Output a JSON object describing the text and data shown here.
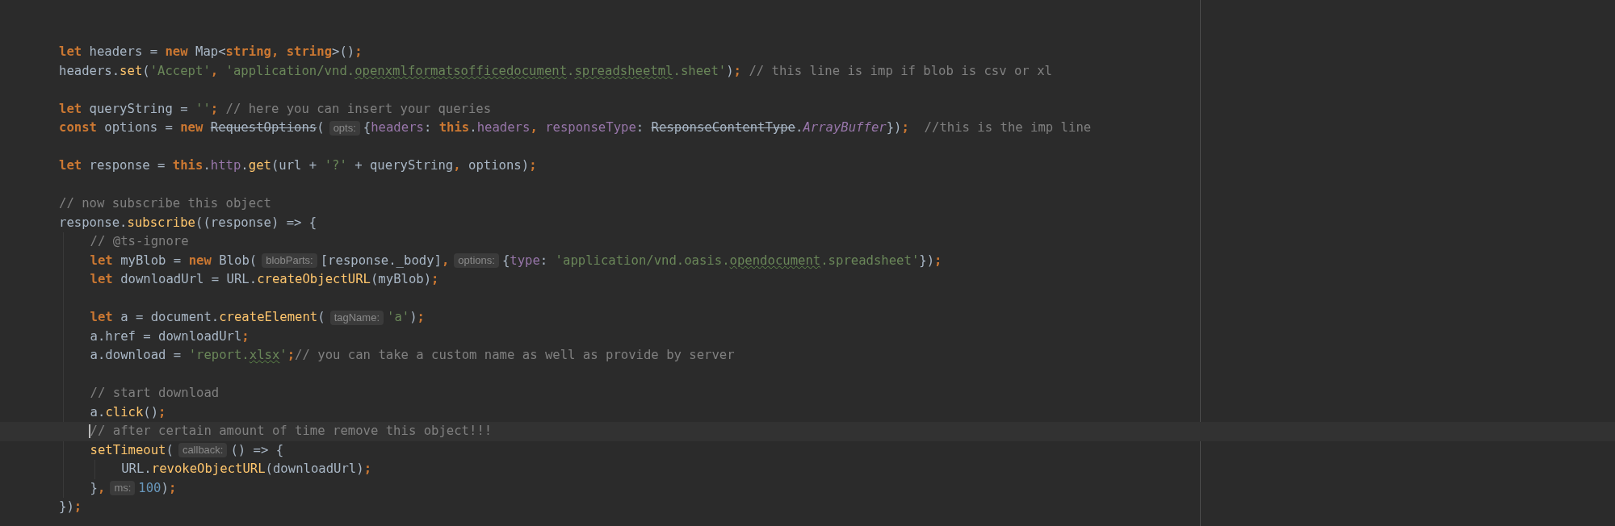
{
  "editor": {
    "lines": [
      {
        "kind": "code",
        "current": false,
        "tokens": [
          {
            "kind": "kw",
            "text": "let"
          },
          {
            "kind": "plain",
            "text": " headers = "
          },
          {
            "kind": "kw",
            "text": "new"
          },
          {
            "kind": "plain",
            "text": " Map<"
          },
          {
            "kind": "kw",
            "text": "string, string"
          },
          {
            "kind": "plain",
            "text": ">()"
          },
          {
            "kind": "punct",
            "text": ";"
          }
        ]
      },
      {
        "kind": "code",
        "current": false,
        "tokens": [
          {
            "kind": "plain",
            "text": "headers."
          },
          {
            "kind": "fn",
            "text": "set"
          },
          {
            "kind": "plain",
            "text": "("
          },
          {
            "kind": "str",
            "text": "'Accept'"
          },
          {
            "kind": "punct",
            "text": ", "
          },
          {
            "kind": "str",
            "text": "'application/vnd."
          },
          {
            "kind": "typo",
            "text": "openxmlformatsofficedocument"
          },
          {
            "kind": "str",
            "text": "."
          },
          {
            "kind": "typo",
            "text": "spreadsheetml"
          },
          {
            "kind": "str",
            "text": ".sheet'"
          },
          {
            "kind": "plain",
            "text": ")"
          },
          {
            "kind": "punct",
            "text": ";"
          },
          {
            "kind": "cmt",
            "text": " // this line is imp if blob is csv or xl"
          }
        ]
      },
      {
        "kind": "blank",
        "current": false
      },
      {
        "kind": "code",
        "current": false,
        "tokens": [
          {
            "kind": "kw",
            "text": "let"
          },
          {
            "kind": "plain",
            "text": " queryString = "
          },
          {
            "kind": "str",
            "text": "''"
          },
          {
            "kind": "punct",
            "text": ";"
          },
          {
            "kind": "cmt",
            "text": " // here you can insert your queries"
          }
        ]
      },
      {
        "kind": "code",
        "current": false,
        "tokens": [
          {
            "kind": "kw",
            "text": "const"
          },
          {
            "kind": "plain",
            "text": " options = "
          },
          {
            "kind": "kw",
            "text": "new "
          },
          {
            "kind": "strike",
            "text": "RequestOptions"
          },
          {
            "kind": "plain",
            "text": "("
          },
          {
            "kind": "hint",
            "text": "opts:"
          },
          {
            "kind": "plain",
            "text": "{"
          },
          {
            "kind": "prop",
            "text": "headers"
          },
          {
            "kind": "plain",
            "text": ": "
          },
          {
            "kind": "kw",
            "text": "this"
          },
          {
            "kind": "plain",
            "text": "."
          },
          {
            "kind": "prop",
            "text": "headers"
          },
          {
            "kind": "punct",
            "text": ", "
          },
          {
            "kind": "prop",
            "text": "responseType"
          },
          {
            "kind": "plain",
            "text": ": "
          },
          {
            "kind": "strike",
            "text": "ResponseContentType"
          },
          {
            "kind": "plain",
            "text": "."
          },
          {
            "kind": "enum",
            "text": "ArrayBuffer"
          },
          {
            "kind": "plain",
            "text": "})"
          },
          {
            "kind": "punct",
            "text": ";"
          },
          {
            "kind": "cmt",
            "text": "  //this is the imp line"
          }
        ]
      },
      {
        "kind": "blank",
        "current": false
      },
      {
        "kind": "code",
        "current": false,
        "tokens": [
          {
            "kind": "kw",
            "text": "let"
          },
          {
            "kind": "plain",
            "text": " response = "
          },
          {
            "kind": "kw",
            "text": "this"
          },
          {
            "kind": "plain",
            "text": "."
          },
          {
            "kind": "prop",
            "text": "http"
          },
          {
            "kind": "plain",
            "text": "."
          },
          {
            "kind": "fn",
            "text": "get"
          },
          {
            "kind": "plain",
            "text": "(url + "
          },
          {
            "kind": "str",
            "text": "'?'"
          },
          {
            "kind": "plain",
            "text": " + queryString"
          },
          {
            "kind": "punct",
            "text": ", "
          },
          {
            "kind": "plain",
            "text": "options)"
          },
          {
            "kind": "punct",
            "text": ";"
          }
        ]
      },
      {
        "kind": "blank",
        "current": false
      },
      {
        "kind": "code",
        "current": false,
        "tokens": [
          {
            "kind": "cmt",
            "text": "// now subscribe this object"
          }
        ]
      },
      {
        "kind": "code",
        "current": false,
        "tokens": [
          {
            "kind": "plain",
            "text": "response."
          },
          {
            "kind": "fn",
            "text": "subscribe"
          },
          {
            "kind": "plain",
            "text": "((response) => {"
          }
        ],
        "children": [
          {
            "kind": "code",
            "current": false,
            "tokens": [
              {
                "kind": "cmt",
                "text": "// @ts-ignore"
              }
            ]
          },
          {
            "kind": "code",
            "current": false,
            "tokens": [
              {
                "kind": "kw",
                "text": "let"
              },
              {
                "kind": "plain",
                "text": " myBlob = "
              },
              {
                "kind": "kw",
                "text": "new"
              },
              {
                "kind": "plain",
                "text": " Blob("
              },
              {
                "kind": "hint",
                "text": "blobParts:"
              },
              {
                "kind": "plain",
                "text": "[response._body]"
              },
              {
                "kind": "punct",
                "text": ","
              },
              {
                "kind": "hint",
                "text": "options:"
              },
              {
                "kind": "plain",
                "text": "{"
              },
              {
                "kind": "prop",
                "text": "type"
              },
              {
                "kind": "plain",
                "text": ": "
              },
              {
                "kind": "str",
                "text": "'application/vnd.oasis."
              },
              {
                "kind": "typo",
                "text": "opendocument"
              },
              {
                "kind": "str",
                "text": ".spreadsheet'"
              },
              {
                "kind": "plain",
                "text": "})"
              },
              {
                "kind": "punct",
                "text": ";"
              }
            ]
          },
          {
            "kind": "code",
            "current": false,
            "tokens": [
              {
                "kind": "kw",
                "text": "let"
              },
              {
                "kind": "plain",
                "text": " downloadUrl = URL."
              },
              {
                "kind": "fn",
                "text": "createObjectURL"
              },
              {
                "kind": "plain",
                "text": "(myBlob)"
              },
              {
                "kind": "punct",
                "text": ";"
              }
            ]
          },
          {
            "kind": "blank",
            "current": false
          },
          {
            "kind": "code",
            "current": false,
            "tokens": [
              {
                "kind": "kw",
                "text": "let"
              },
              {
                "kind": "plain",
                "text": " a = document."
              },
              {
                "kind": "fn",
                "text": "createElement"
              },
              {
                "kind": "plain",
                "text": "("
              },
              {
                "kind": "hint",
                "text": "tagName:"
              },
              {
                "kind": "str",
                "text": "'a'"
              },
              {
                "kind": "plain",
                "text": ")"
              },
              {
                "kind": "punct",
                "text": ";"
              }
            ]
          },
          {
            "kind": "code",
            "current": false,
            "tokens": [
              {
                "kind": "plain",
                "text": "a.href = downloadUrl"
              },
              {
                "kind": "punct",
                "text": ";"
              }
            ]
          },
          {
            "kind": "code",
            "current": false,
            "tokens": [
              {
                "kind": "plain",
                "text": "a.download = "
              },
              {
                "kind": "str",
                "text": "'report."
              },
              {
                "kind": "typo",
                "text": "xlsx"
              },
              {
                "kind": "str",
                "text": "'"
              },
              {
                "kind": "punct",
                "text": ";"
              },
              {
                "kind": "cmt",
                "text": "// you can take a custom name as well as provide by server"
              }
            ]
          },
          {
            "kind": "blank",
            "current": false
          },
          {
            "kind": "code",
            "current": false,
            "tokens": [
              {
                "kind": "cmt",
                "text": "// start download"
              }
            ]
          },
          {
            "kind": "code",
            "current": false,
            "tokens": [
              {
                "kind": "plain",
                "text": "a."
              },
              {
                "kind": "fn",
                "text": "click"
              },
              {
                "kind": "plain",
                "text": "()"
              },
              {
                "kind": "punct",
                "text": ";"
              }
            ]
          },
          {
            "kind": "code",
            "current": true,
            "tokens": [
              {
                "kind": "cmt",
                "text": "// after certain amount of time remove this object!!!"
              }
            ]
          },
          {
            "kind": "code",
            "current": false,
            "tokens": [
              {
                "kind": "fn",
                "text": "setTimeout"
              },
              {
                "kind": "plain",
                "text": "("
              },
              {
                "kind": "hint",
                "text": "callback:"
              },
              {
                "kind": "plain",
                "text": "() => {"
              }
            ],
            "children": [
              {
                "kind": "code",
                "current": false,
                "tokens": [
                  {
                    "kind": "plain",
                    "text": "URL."
                  },
                  {
                    "kind": "fn",
                    "text": "revokeObjectURL"
                  },
                  {
                    "kind": "plain",
                    "text": "(downloadUrl)"
                  },
                  {
                    "kind": "punct",
                    "text": ";"
                  }
                ]
              }
            ]
          },
          {
            "kind": "code",
            "current": false,
            "tokens": [
              {
                "kind": "plain",
                "text": "}"
              },
              {
                "kind": "punct",
                "text": ","
              },
              {
                "kind": "hint",
                "text": "ms:"
              },
              {
                "kind": "num",
                "text": "100"
              },
              {
                "kind": "plain",
                "text": ")"
              },
              {
                "kind": "punct",
                "text": ";"
              }
            ]
          }
        ]
      },
      {
        "kind": "code",
        "current": false,
        "tokens": [
          {
            "kind": "plain",
            "text": "})"
          },
          {
            "kind": "punct",
            "text": ";"
          }
        ]
      }
    ]
  }
}
